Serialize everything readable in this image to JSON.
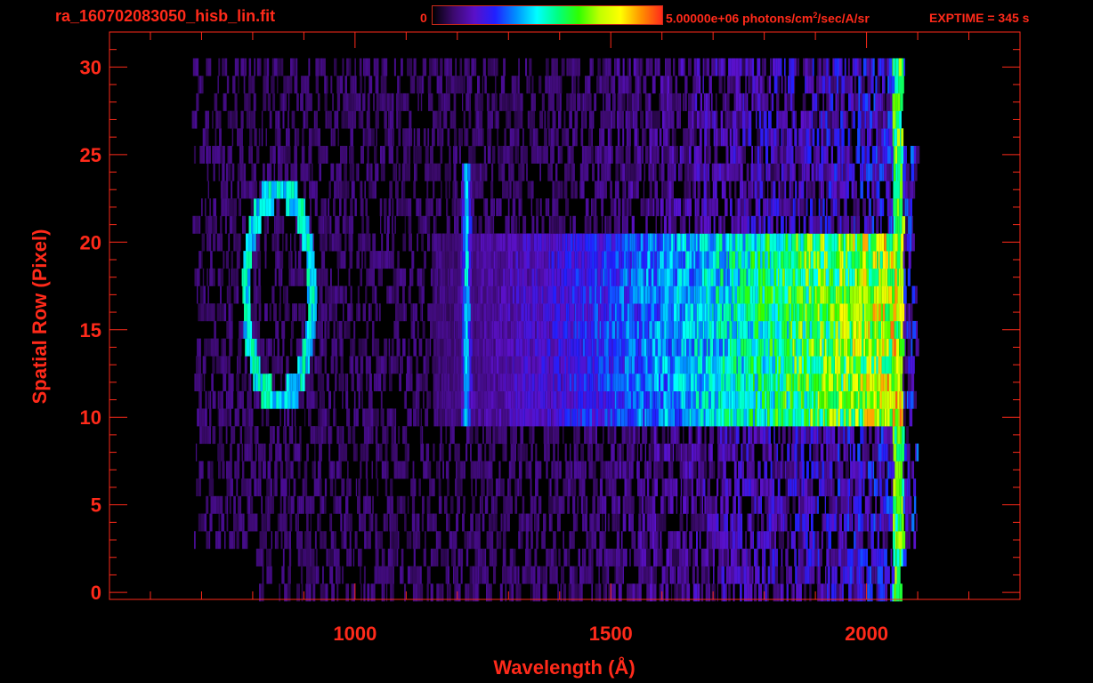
{
  "header": {
    "file_title": "ra_160702083050_hisb_lin.fit",
    "colorbar_min": "0",
    "colorbar_max_value": "5.00000e+06 photons/cm",
    "colorbar_max_exp": "2",
    "colorbar_max_unit": "/sec/A/sr",
    "exptime": "EXPTIME = 345 s"
  },
  "colors": {
    "axis": "#ff2a1a",
    "background": "#000000",
    "colormap": [
      "#000000",
      "#3c0a6e",
      "#5a10c8",
      "#2020ff",
      "#0090ff",
      "#00ffff",
      "#00ff80",
      "#30ff00",
      "#c0ff00",
      "#ffff00",
      "#ff9000",
      "#ff2a1a"
    ]
  },
  "chart_data": {
    "type": "heatmap",
    "title": "ra_160702083050_hisb_lin.fit",
    "xlabel": "Wavelength (Å)",
    "ylabel": "Spatial Row (Pixel)",
    "xlim": [
      520,
      2300
    ],
    "ylim": [
      -0.4,
      32
    ],
    "x_ticks": [
      1000,
      1500,
      2000
    ],
    "x_minor_step": 100,
    "y_ticks": [
      0,
      5,
      10,
      15,
      20,
      25,
      30
    ],
    "y_minor_step": 1,
    "colorbar_range": [
      0,
      5000000
    ],
    "colorbar_units": "photons/cm^2/sec/A/sr",
    "data_extent": {
      "x_range": [
        680,
        2080
      ],
      "y_rows": [
        0,
        30
      ]
    },
    "features": [
      {
        "type": "continuum_band",
        "rows": [
          10,
          20
        ],
        "x_range": [
          1150,
          2070
        ],
        "peak_fraction": 0.82
      },
      {
        "type": "continuum_stripe",
        "row": 11.5,
        "x_range": [
          1600,
          2065
        ],
        "peak_fraction": 0.88
      },
      {
        "type": "continuum_stripe",
        "row": 16.5,
        "x_range": [
          1600,
          2065
        ],
        "peak_fraction": 0.92
      },
      {
        "type": "emission_line",
        "wavelength": 1216,
        "rows": [
          10,
          24
        ],
        "peak_fraction": 0.55
      },
      {
        "type": "ring",
        "center_wavelength": 850,
        "center_row": 17,
        "rows": [
          10,
          24
        ],
        "peak_fraction": 0.5
      },
      {
        "type": "edge",
        "wavelength": 2060,
        "rows": [
          0,
          30
        ],
        "peak_fraction": 0.75
      }
    ]
  }
}
